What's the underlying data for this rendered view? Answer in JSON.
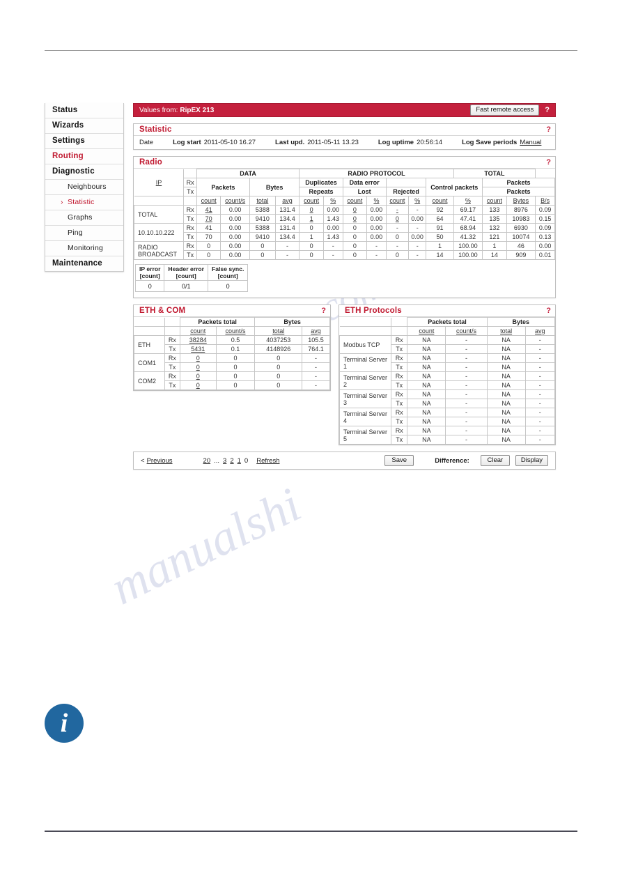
{
  "sidebar": {
    "items": [
      {
        "label": "Status",
        "level": "top",
        "active": false
      },
      {
        "label": "Wizards",
        "level": "top",
        "active": false
      },
      {
        "label": "Settings",
        "level": "top",
        "active": false
      },
      {
        "label": "Routing",
        "level": "top",
        "active": true
      },
      {
        "label": "Diagnostic",
        "level": "top",
        "active": false
      },
      {
        "label": "Neighbours",
        "level": "sub",
        "active": false
      },
      {
        "label": "Statistic",
        "level": "sub",
        "active": true
      },
      {
        "label": "Graphs",
        "level": "sub",
        "active": false
      },
      {
        "label": "Ping",
        "level": "sub",
        "active": false
      },
      {
        "label": "Monitoring",
        "level": "sub",
        "active": false
      },
      {
        "label": "Maintenance",
        "level": "top",
        "active": false
      }
    ]
  },
  "topbar": {
    "values_from_label": "Values from:",
    "device_name": "RipEX 213",
    "fast_remote_access": "Fast remote access",
    "help": "?"
  },
  "statistic": {
    "title": "Statistic",
    "help": "?",
    "date_label": "Date",
    "log_start_label": "Log start",
    "log_start_value": "2011-05-10 16.27",
    "last_upd_label": "Last upd.",
    "last_upd_value": "2011-05-11 13.23",
    "log_uptime_label": "Log uptime",
    "log_uptime_value": "20:56:14",
    "log_save_label": "Log Save periods",
    "log_save_value": "Manual"
  },
  "radio": {
    "title": "Radio",
    "help": "?",
    "group_headers": [
      "DATA",
      "RADIO PROTOCOL",
      "TOTAL"
    ],
    "ip_header": "IP",
    "rx_label": "Rx",
    "tx_label": "Tx",
    "sub_headers": {
      "packets": "Packets",
      "bytes": "Bytes",
      "duplicates": "Duplicates",
      "repeats": "Repeats",
      "data_error": "Data error",
      "lost": "Lost",
      "rejected": "Rejected",
      "control_packets": "Control packets",
      "total_packets_1": "Packets",
      "total_packets_2": "Packets"
    },
    "col_headers": [
      "count",
      "count/s",
      "total",
      "avg",
      "count",
      "%",
      "count",
      "%",
      "count",
      "%",
      "count",
      "%",
      "count",
      "Bytes",
      "B/s"
    ],
    "rows": [
      {
        "name": "TOTAL",
        "dir": "Rx",
        "link": true,
        "cells": [
          "41",
          "0.00",
          "5388",
          "131.4",
          "0",
          "0.00",
          "0",
          "0.00",
          "-",
          "-",
          "92",
          "69.17",
          "133",
          "8976",
          "0.09"
        ]
      },
      {
        "name": "TOTAL",
        "dir": "Tx",
        "link": true,
        "cells": [
          "70",
          "0.00",
          "9410",
          "134.4",
          "1",
          "1.43",
          "0",
          "0.00",
          "0",
          "0.00",
          "64",
          "47.41",
          "135",
          "10983",
          "0.15"
        ]
      },
      {
        "name": "10.10.10.222",
        "dir": "Rx",
        "link": false,
        "cells": [
          "41",
          "0.00",
          "5388",
          "131.4",
          "0",
          "0.00",
          "0",
          "0.00",
          "-",
          "-",
          "91",
          "68.94",
          "132",
          "6930",
          "0.09"
        ]
      },
      {
        "name": "10.10.10.222",
        "dir": "Tx",
        "link": false,
        "cells": [
          "70",
          "0.00",
          "9410",
          "134.4",
          "1",
          "1.43",
          "0",
          "0.00",
          "0",
          "0.00",
          "50",
          "41.32",
          "121",
          "10074",
          "0.13"
        ]
      },
      {
        "name": "RADIO BROADCAST",
        "dir": "Rx",
        "link": false,
        "cells": [
          "0",
          "0.00",
          "0",
          "-",
          "0",
          "-",
          "0",
          "-",
          "-",
          "-",
          "1",
          "100.00",
          "1",
          "46",
          "0.00"
        ]
      },
      {
        "name": "RADIO BROADCAST",
        "dir": "Tx",
        "link": false,
        "cells": [
          "0",
          "0.00",
          "0",
          "-",
          "0",
          "-",
          "0",
          "-",
          "0",
          "-",
          "14",
          "100.00",
          "14",
          "909",
          "0.01"
        ]
      }
    ],
    "errors": {
      "headers": [
        {
          "l1": "IP error",
          "l2": "[count]"
        },
        {
          "l1": "Header error",
          "l2": "[count]"
        },
        {
          "l1": "False sync.",
          "l2": "[count]"
        }
      ],
      "values": [
        "0",
        "0/1",
        "0"
      ]
    }
  },
  "eth_com": {
    "title": "ETH & COM",
    "help": "?",
    "group_headers": [
      "Packets total",
      "Bytes"
    ],
    "col_headers": [
      "count",
      "count/s",
      "total",
      "avg"
    ],
    "rows": [
      {
        "name": "ETH",
        "dir": "Rx",
        "link": true,
        "cells": [
          "38284",
          "0.5",
          "4037253",
          "105.5"
        ]
      },
      {
        "name": "ETH",
        "dir": "Tx",
        "link": true,
        "cells": [
          "5431",
          "0.1",
          "4148926",
          "764.1"
        ]
      },
      {
        "name": "COM1",
        "dir": "Rx",
        "link": true,
        "cells": [
          "0",
          "0",
          "0",
          "-"
        ]
      },
      {
        "name": "COM1",
        "dir": "Tx",
        "link": true,
        "cells": [
          "0",
          "0",
          "0",
          "-"
        ]
      },
      {
        "name": "COM2",
        "dir": "Rx",
        "link": true,
        "cells": [
          "0",
          "0",
          "0",
          "-"
        ]
      },
      {
        "name": "COM2",
        "dir": "Tx",
        "link": true,
        "cells": [
          "0",
          "0",
          "0",
          "-"
        ]
      }
    ]
  },
  "eth_protocols": {
    "title": "ETH Protocols",
    "help": "?",
    "group_headers": [
      "Packets total",
      "Bytes"
    ],
    "col_headers": [
      "count",
      "count/s",
      "total",
      "avg"
    ],
    "rows": [
      {
        "name": "Modbus TCP",
        "dir": "Rx",
        "cells": [
          "NA",
          "-",
          "NA",
          "-"
        ]
      },
      {
        "name": "Modbus TCP",
        "dir": "Tx",
        "cells": [
          "NA",
          "-",
          "NA",
          "-"
        ]
      },
      {
        "name": "Terminal Server 1",
        "dir": "Rx",
        "cells": [
          "NA",
          "-",
          "NA",
          "-"
        ]
      },
      {
        "name": "Terminal Server 1",
        "dir": "Tx",
        "cells": [
          "NA",
          "-",
          "NA",
          "-"
        ]
      },
      {
        "name": "Terminal Server 2",
        "dir": "Rx",
        "cells": [
          "NA",
          "-",
          "NA",
          "-"
        ]
      },
      {
        "name": "Terminal Server 2",
        "dir": "Tx",
        "cells": [
          "NA",
          "-",
          "NA",
          "-"
        ]
      },
      {
        "name": "Terminal Server 3",
        "dir": "Rx",
        "cells": [
          "NA",
          "-",
          "NA",
          "-"
        ]
      },
      {
        "name": "Terminal Server 3",
        "dir": "Tx",
        "cells": [
          "NA",
          "-",
          "NA",
          "-"
        ]
      },
      {
        "name": "Terminal Server 4",
        "dir": "Rx",
        "cells": [
          "NA",
          "-",
          "NA",
          "-"
        ]
      },
      {
        "name": "Terminal Server 4",
        "dir": "Tx",
        "cells": [
          "NA",
          "-",
          "NA",
          "-"
        ]
      },
      {
        "name": "Terminal Server 5",
        "dir": "Rx",
        "cells": [
          "NA",
          "-",
          "NA",
          "-"
        ]
      },
      {
        "name": "Terminal Server 5",
        "dir": "Tx",
        "cells": [
          "NA",
          "-",
          "NA",
          "-"
        ]
      }
    ]
  },
  "footer": {
    "prev_arrow": "<",
    "previous": "Previous",
    "pages": [
      "20",
      "...",
      "3",
      "2",
      "1"
    ],
    "current_page": "0",
    "refresh": "Refresh",
    "save": "Save",
    "difference_label": "Difference:",
    "clear": "Clear",
    "display": "Display"
  },
  "info_icon": {
    "glyph": "i"
  },
  "watermark": {
    "line1": "ve.com",
    "line2": "manualshi"
  },
  "colors": {
    "brand_red": "#c4203d",
    "title_red": "#c0182f",
    "info_blue": "#21679f"
  }
}
